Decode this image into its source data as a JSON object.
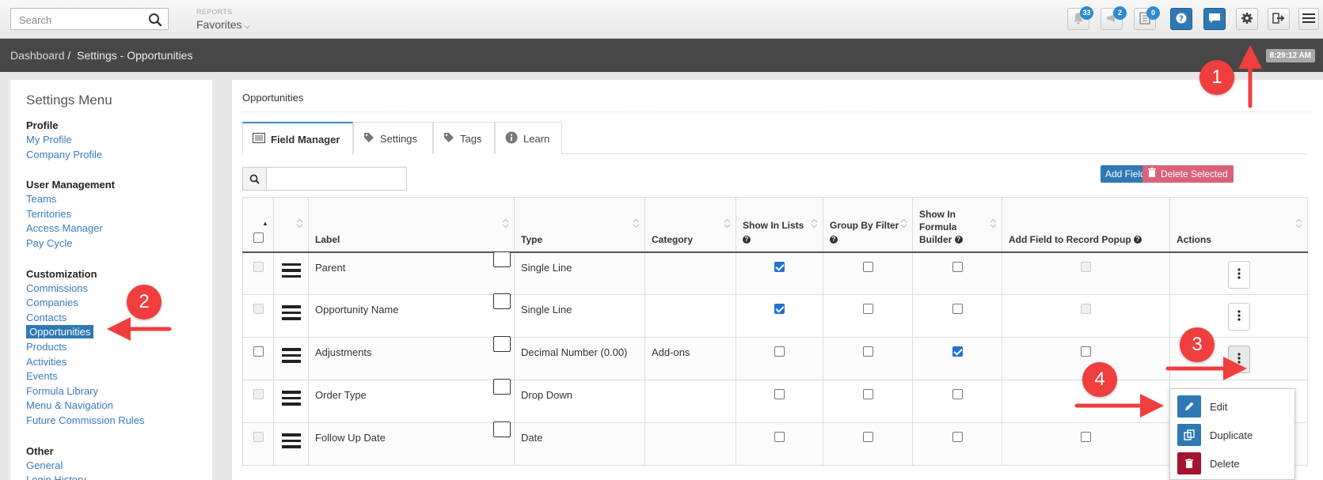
{
  "topbar": {
    "search_placeholder": "Search",
    "reports_label": "REPORTS",
    "favorites_label": "Favorites",
    "notifications_count": "33",
    "announcements_count": "2",
    "tasks_count": "0"
  },
  "breadcrumb": {
    "dashboard": "Dashboard",
    "separator": "/",
    "current": "Settings - Opportunities",
    "time": "8:29:12 AM"
  },
  "sidebar": {
    "title": "Settings Menu",
    "sections": [
      {
        "heading": "Profile",
        "items": [
          "My Profile",
          "Company Profile"
        ]
      },
      {
        "heading": "User Management",
        "items": [
          "Teams",
          "Territories",
          "Access Manager",
          "Pay Cycle"
        ]
      },
      {
        "heading": "Customization",
        "items": [
          "Commissions",
          "Companies",
          "Contacts",
          "Opportunities",
          "Products",
          "Activities",
          "Events",
          "Formula Library",
          "Menu & Navigation",
          "Future Commission Rules"
        ]
      },
      {
        "heading": "Other",
        "items": [
          "General",
          "Login History"
        ]
      }
    ],
    "active_item": "Opportunities"
  },
  "main": {
    "title": "Opportunities",
    "tabs": [
      "Field Manager",
      "Settings",
      "Tags",
      "Learn"
    ],
    "active_tab": "Field Manager",
    "add_field_label": "Add Field",
    "delete_selected_label": "Delete Selected"
  },
  "table": {
    "headers": {
      "label": "Label",
      "type": "Type",
      "category": "Category",
      "show_in_lists": "Show In Lists",
      "group_by_filter": "Group By Filter",
      "show_in_formula_builder_1": "Show In",
      "show_in_formula_builder_2": "Formula",
      "show_in_formula_builder_3": "Builder",
      "add_to_popup": "Add Field to Record Popup",
      "actions": "Actions"
    },
    "rows": [
      {
        "label": "Parent",
        "type": "Single Line",
        "category": "",
        "show_in_lists": true,
        "group_by": false,
        "formula": false,
        "popup": "disabled",
        "select": "disabled"
      },
      {
        "label": "Opportunity Name",
        "type": "Single Line",
        "category": "",
        "show_in_lists": true,
        "group_by": false,
        "formula": false,
        "popup": "disabled",
        "select": "disabled"
      },
      {
        "label": "Adjustments",
        "type": "Decimal Number (0.00)",
        "category": "Add-ons",
        "show_in_lists": false,
        "group_by": false,
        "formula": true,
        "popup": "off",
        "select": "enabled"
      },
      {
        "label": "Order Type",
        "type": "Drop Down",
        "category": "",
        "show_in_lists": false,
        "group_by": false,
        "formula": false,
        "popup": "hidden",
        "select": "disabled"
      },
      {
        "label": "Follow Up Date",
        "type": "Date",
        "category": "",
        "show_in_lists": false,
        "group_by": false,
        "formula": false,
        "popup": "hidden",
        "select": "disabled"
      }
    ]
  },
  "actions_menu": {
    "edit": "Edit",
    "duplicate": "Duplicate",
    "delete": "Delete"
  },
  "annotations": {
    "step1": "1",
    "step2": "2",
    "step3": "3",
    "step4": "4"
  },
  "colors": {
    "primary": "#2e79b5",
    "danger": "#d9627a",
    "delete_icon_bg": "#a3152f",
    "annotation": "#f03e3e",
    "link": "#3b7bbf"
  }
}
